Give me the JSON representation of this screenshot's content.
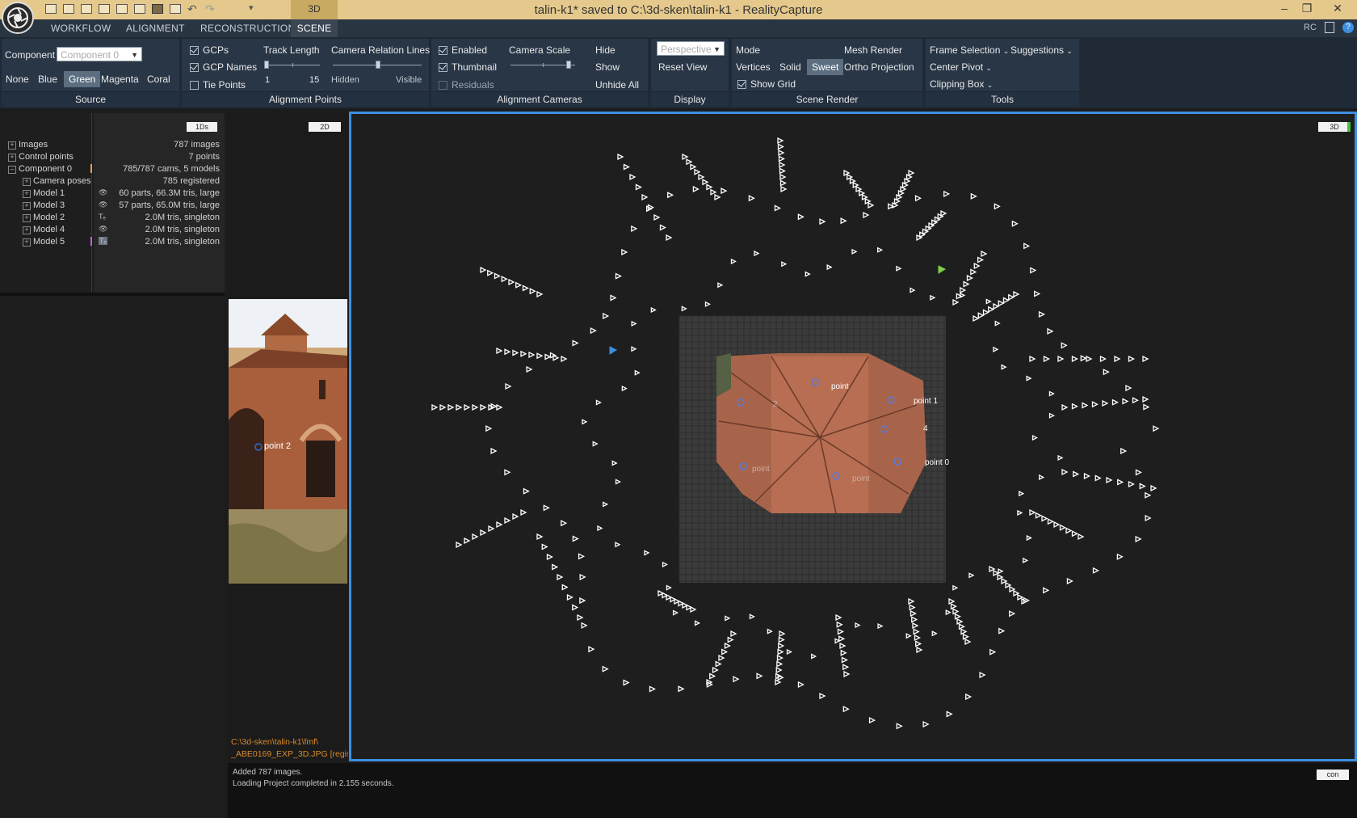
{
  "titlebar": {
    "title": "talin-k1* saved to C:\\3d-sken\\talin-k1 - RealityCapture",
    "view_tab": "3D",
    "minimize": "–",
    "restore": "❐",
    "close": "✕"
  },
  "menu": {
    "tabs": [
      "WORKFLOW",
      "ALIGNMENT",
      "RECONSTRUCTION",
      "SCENE"
    ],
    "rc_label": "RC"
  },
  "ribbon": {
    "source": {
      "label": "Source",
      "component_label": "Component",
      "component_value": "Component 0",
      "colors": [
        "None",
        "Blue",
        "Green",
        "Magenta",
        "Coral"
      ],
      "selected_color": "Green"
    },
    "alignment_points": {
      "label": "Alignment Points",
      "gcps": "GCPs",
      "gcp_names": "GCP Names",
      "tie_points": "Tie Points",
      "track_length": "Track Length",
      "track_min": "1",
      "track_max": "15",
      "camera_relation_lines": "Camera Relation Lines",
      "hidden": "Hidden",
      "visible": "Visible"
    },
    "alignment_cameras": {
      "label": "Alignment Cameras",
      "enabled": "Enabled",
      "thumbnail": "Thumbnail",
      "residuals": "Residuals",
      "camera_scale": "Camera Scale",
      "hide": "Hide",
      "show": "Show",
      "unhide_all": "Unhide All"
    },
    "display": {
      "label": "Display",
      "projection": "Perspective",
      "reset_view": "Reset View"
    },
    "scene_render": {
      "label": "Scene Render",
      "mode": "Mode",
      "mesh_render": "Mesh Render",
      "vertices": "Vertices",
      "solid": "Solid",
      "sweet": "Sweet",
      "ortho_projection": "Ortho Projection",
      "show_grid": "Show Grid"
    },
    "tools": {
      "label": "Tools",
      "frame_selection": "Frame Selection",
      "suggestions": "Suggestions",
      "center_pivot": "Center Pivot",
      "clipping_box": "Clipping Box"
    }
  },
  "tree": {
    "tag": "1Ds",
    "rows": [
      {
        "label": "Images",
        "info": "787 images"
      },
      {
        "label": "Control points",
        "info": "7 points"
      },
      {
        "label": "Component 0",
        "info": "785/787 cams, 5 models"
      },
      {
        "label": "Camera poses",
        "info": "785 registered"
      },
      {
        "label": "Model 1",
        "info": "60 parts, 66.3M tris, large"
      },
      {
        "label": "Model 3",
        "info": "57 parts, 65.0M tris, large"
      },
      {
        "label": "Model 2",
        "info": "2.0M tris, singleton"
      },
      {
        "label": "Model 4",
        "info": "2.0M tris, singleton"
      },
      {
        "label": "Model 5",
        "info": "2.0M tris, singleton"
      }
    ]
  },
  "panel2d": {
    "tag": "2D",
    "point_label": "point 2",
    "path_line1": "C:\\3d-sken\\talin-k1\\fmf\\",
    "path_line2": "_ABE0169_EXP_3D.JPG [regis"
  },
  "view3d": {
    "tag": "3D",
    "gcp_labels": [
      "point",
      "2",
      "point 1",
      "4",
      "point 0",
      "point",
      "point"
    ]
  },
  "console": {
    "lines": [
      "Added 787 images.",
      "Loading Project completed in 2.155 seconds."
    ],
    "button": "con"
  },
  "colors": {
    "accent_blue": "#3d8fe0",
    "title_bar": "#e5c98c",
    "ribbon_group": "#283646",
    "selected_button": "#5c6e80",
    "path_orange": "#d98a2a"
  }
}
